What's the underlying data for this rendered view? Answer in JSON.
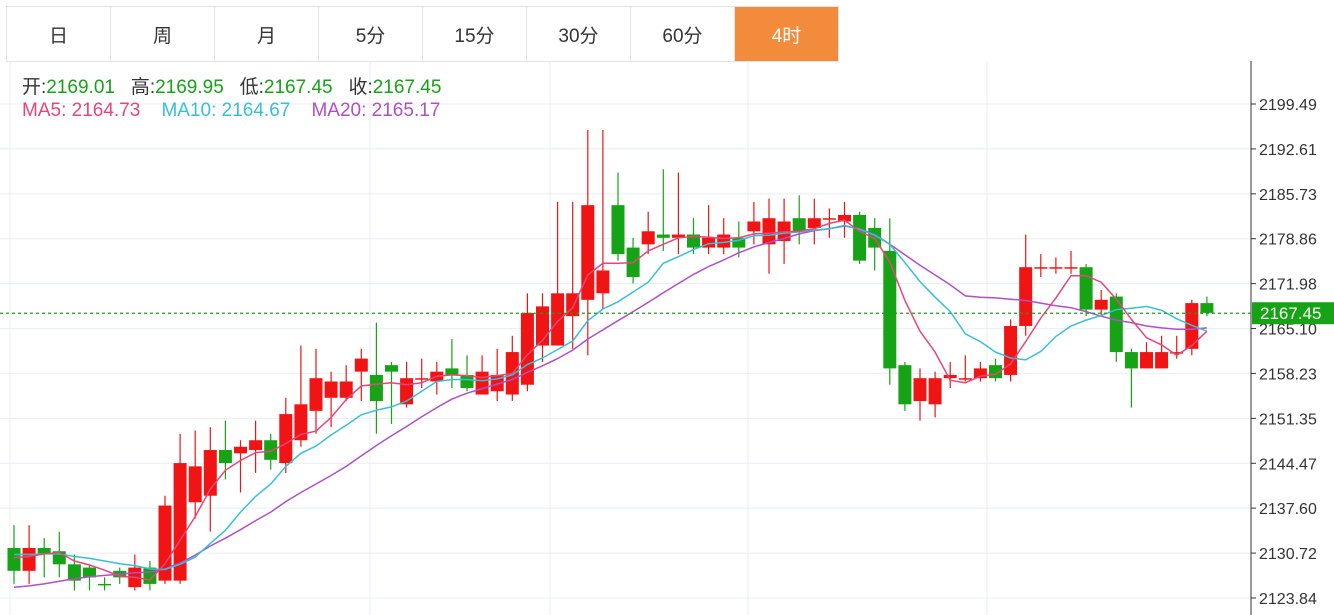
{
  "tabs": [
    {
      "label": "日",
      "active": false
    },
    {
      "label": "周",
      "active": false
    },
    {
      "label": "月",
      "active": false
    },
    {
      "label": "5分",
      "active": false
    },
    {
      "label": "15分",
      "active": false
    },
    {
      "label": "30分",
      "active": false
    },
    {
      "label": "60分",
      "active": false
    },
    {
      "label": "4时",
      "active": true
    }
  ],
  "ohlc_info": {
    "open_label": "开:",
    "open": "2169.01",
    "high_label": "高:",
    "high": "2169.95",
    "low_label": "低:",
    "low": "2167.45",
    "close_label": "收:",
    "close": "2167.45"
  },
  "ma_info": {
    "ma5_label": "MA5:",
    "ma5": "2164.73",
    "ma10_label": "MA10:",
    "ma10": "2164.67",
    "ma20_label": "MA20:",
    "ma20": "2165.17"
  },
  "colors": {
    "up": "#f01414",
    "down": "#16a316",
    "ma5": "#e8457a",
    "ma10": "#36c0d6",
    "ma20": "#b04fc7",
    "active_tab": "#f28b3c",
    "last_price": "#16a316"
  },
  "chart_data": {
    "type": "candlestick",
    "y_ticks": [
      "2199.49",
      "2192.61",
      "2185.73",
      "2178.86",
      "2171.98",
      "2165.10",
      "2158.23",
      "2151.35",
      "2144.47",
      "2137.60",
      "2130.72",
      "2123.84"
    ],
    "ylim": [
      2123.84,
      2199.49
    ],
    "last_price": 2167.45,
    "last_price_label": "2167.45",
    "grid": true,
    "candles": [
      [
        2131.5,
        2128.0,
        2135.0,
        2126.0
      ],
      [
        2128.0,
        2131.5,
        2135.0,
        2126.0
      ],
      [
        2131.5,
        2130.5,
        2133.0,
        2127.0
      ],
      [
        2131.0,
        2129.0,
        2134.0,
        2127.0
      ],
      [
        2129.0,
        2126.5,
        2130.5,
        2125.0
      ],
      [
        2128.5,
        2127.0,
        2129.0,
        2125.0
      ],
      [
        2126.0,
        2125.8,
        2127.0,
        2125.0
      ],
      [
        2128.0,
        2127.0,
        2128.5,
        2126.0
      ],
      [
        2125.5,
        2128.5,
        2130.5,
        2125.0
      ],
      [
        2128.5,
        2126.0,
        2129.5,
        2125.0
      ],
      [
        2126.5,
        2138.0,
        2139.5,
        2126.0
      ],
      [
        2126.5,
        2144.5,
        2149.0,
        2126.0
      ],
      [
        2138.5,
        2144.0,
        2149.5,
        2136.0
      ],
      [
        2139.5,
        2146.5,
        2150.0,
        2134.0
      ],
      [
        2146.5,
        2144.5,
        2151.0,
        2142.0
      ],
      [
        2146.0,
        2147.0,
        2148.0,
        2140.0
      ],
      [
        2146.5,
        2148.0,
        2151.0,
        2143.0
      ],
      [
        2148.0,
        2145.0,
        2149.0,
        2143.5
      ],
      [
        2144.5,
        2152.0,
        2154.5,
        2143.0
      ],
      [
        2148.0,
        2153.5,
        2162.5,
        2147.0
      ],
      [
        2152.5,
        2157.5,
        2162.0,
        2149.0
      ],
      [
        2154.5,
        2157.0,
        2158.5,
        2150.0
      ],
      [
        2154.5,
        2157.0,
        2159.5,
        2154.0
      ],
      [
        2158.5,
        2160.5,
        2162.0,
        2154.0
      ],
      [
        2158.0,
        2154.0,
        2166.0,
        2149.0
      ],
      [
        2159.5,
        2158.5,
        2160.0,
        2150.5
      ],
      [
        2153.5,
        2157.5,
        2160.0,
        2153.0
      ],
      [
        2157.5,
        2157.5,
        2160.5,
        2156.0
      ],
      [
        2157.0,
        2158.5,
        2160.0,
        2155.0
      ],
      [
        2159.0,
        2158.0,
        2163.5,
        2156.0
      ],
      [
        2158.0,
        2156.0,
        2161.0,
        2155.5
      ],
      [
        2155.0,
        2158.5,
        2161.0,
        2155.0
      ],
      [
        2155.5,
        2158.0,
        2162.0,
        2154.0
      ],
      [
        2155.0,
        2161.5,
        2164.0,
        2154.0
      ],
      [
        2156.5,
        2167.5,
        2170.5,
        2155.5
      ],
      [
        2162.5,
        2168.5,
        2170.5,
        2160.0
      ],
      [
        2162.5,
        2170.5,
        2184.5,
        2163.0
      ],
      [
        2167.0,
        2170.5,
        2184.5,
        2162.0
      ],
      [
        2169.5,
        2184.0,
        2195.5,
        2161.0
      ],
      [
        2170.5,
        2174.0,
        2195.5,
        2168.0
      ],
      [
        2184.0,
        2176.5,
        2189.0,
        2175.5
      ],
      [
        2177.5,
        2173.0,
        2179.0,
        2172.0
      ],
      [
        2178.0,
        2180.0,
        2183.0,
        2176.5
      ],
      [
        2179.5,
        2179.0,
        2189.5,
        2177.0
      ],
      [
        2179.0,
        2179.5,
        2189.0,
        2176.5
      ],
      [
        2179.5,
        2177.5,
        2182.0,
        2176.5
      ],
      [
        2177.5,
        2179.0,
        2184.0,
        2176.5
      ],
      [
        2177.5,
        2179.5,
        2182.0,
        2176.5
      ],
      [
        2179.0,
        2177.5,
        2181.5,
        2176.0
      ],
      [
        2180.0,
        2181.5,
        2184.5,
        2178.0
      ],
      [
        2178.0,
        2182.0,
        2185.0,
        2173.5
      ],
      [
        2178.5,
        2181.5,
        2185.0,
        2175.0
      ],
      [
        2182.0,
        2180.0,
        2185.5,
        2178.0
      ],
      [
        2180.5,
        2182.0,
        2185.0,
        2178.0
      ],
      [
        2182.0,
        2182.0,
        2183.5,
        2179.0
      ],
      [
        2181.5,
        2182.5,
        2184.5,
        2179.0
      ],
      [
        2182.5,
        2175.5,
        2183.0,
        2175.0
      ],
      [
        2180.5,
        2177.5,
        2182.0,
        2174.0
      ],
      [
        2177.0,
        2159.0,
        2182.0,
        2156.5
      ],
      [
        2159.5,
        2153.5,
        2160.0,
        2152.5
      ],
      [
        2154.0,
        2157.5,
        2159.0,
        2151.0
      ],
      [
        2153.5,
        2157.5,
        2158.5,
        2151.5
      ],
      [
        2157.5,
        2158.0,
        2160.0,
        2156.0
      ],
      [
        2157.5,
        2157.5,
        2161.0,
        2157.0
      ],
      [
        2157.5,
        2159.0,
        2160.0,
        2157.0
      ],
      [
        2159.5,
        2157.5,
        2160.5,
        2157.0
      ],
      [
        2158.0,
        2165.5,
        2166.5,
        2157.0
      ],
      [
        2165.5,
        2174.5,
        2179.5,
        2164.0
      ],
      [
        2174.5,
        2174.5,
        2176.5,
        2173.0
      ],
      [
        2174.5,
        2174.5,
        2176.0,
        2173.5
      ],
      [
        2174.5,
        2174.5,
        2177.0,
        2173.5
      ],
      [
        2174.5,
        2168.0,
        2175.0,
        2167.0
      ],
      [
        2168.0,
        2169.5,
        2171.0,
        2167.0
      ],
      [
        2170.0,
        2161.5,
        2170.5,
        2160.0
      ],
      [
        2161.5,
        2159.0,
        2162.0,
        2153.0
      ],
      [
        2159.0,
        2161.5,
        2163.0,
        2159.0
      ],
      [
        2159.0,
        2161.5,
        2164.0,
        2159.0
      ],
      [
        2161.5,
        2161.5,
        2164.0,
        2160.5
      ],
      [
        2162.0,
        2169.0,
        2169.5,
        2161.0
      ],
      [
        2169.0,
        2167.5,
        2170.0,
        2167.0
      ]
    ],
    "ma5": [
      2130.0,
      2130.2,
      2130.6,
      2130.8,
      2129.5,
      2128.9,
      2128.1,
      2127.2,
      2127.0,
      2126.6,
      2129.1,
      2132.7,
      2136.3,
      2140.5,
      2143.4,
      2144.9,
      2146.1,
      2146.3,
      2147.5,
      2148.9,
      2149.4,
      2151.5,
      2154.2,
      2156.3,
      2156.6,
      2156.8,
      2156.5,
      2156.8,
      2157.8,
      2158.0,
      2157.9,
      2157.6,
      2157.9,
      2158.2,
      2161.1,
      2163.3,
      2166.2,
      2168.3,
      2173.3,
      2175.1,
      2175.1,
      2175.2,
      2177.0,
      2178.0,
      2179.0,
      2179.2,
      2179.1,
      2178.9,
      2179.0,
      2179.6,
      2179.7,
      2179.9,
      2180.0,
      2180.4,
      2181.2,
      2181.7,
      2180.0,
      2178.9,
      2175.3,
      2169.4,
      2164.7,
      2161.5,
      2157.2,
      2156.8,
      2157.8,
      2158.1,
      2159.7,
      2163.1,
      2166.7,
      2169.8,
      2173.2,
      2173.2,
      2172.2,
      2169.6,
      2166.5,
      2163.7,
      2162.6,
      2161.0,
      2162.5,
      2164.7
    ],
    "ma10": [
      2130.5,
      2130.5,
      2130.6,
      2130.6,
      2130.2,
      2129.9,
      2129.5,
      2129.1,
      2128.8,
      2128.3,
      2128.2,
      2129.0,
      2130.1,
      2132.2,
      2134.2,
      2137.0,
      2139.4,
      2141.3,
      2144.0,
      2146.0,
      2147.1,
      2148.8,
      2150.3,
      2151.9,
      2152.6,
      2153.1,
      2154.0,
      2155.5,
      2157.0,
      2157.3,
      2157.3,
      2157.1,
      2157.4,
      2158.0,
      2159.6,
      2160.6,
      2161.9,
      2163.2,
      2166.3,
      2168.1,
      2169.2,
      2170.7,
      2172.2,
      2175.1,
      2176.1,
      2177.2,
      2178.1,
      2178.3,
      2178.6,
      2179.3,
      2179.4,
      2179.7,
      2179.9,
      2180.2,
      2180.4,
      2180.9,
      2180.3,
      2179.4,
      2178.0,
      2175.2,
      2172.3,
      2169.9,
      2167.7,
      2164.3,
      2163.1,
      2161.5,
      2160.6,
      2160.3,
      2161.6,
      2163.9,
      2165.5,
      2166.4,
      2167.1,
      2168.0,
      2168.2,
      2168.5,
      2167.9,
      2166.6,
      2165.6,
      2164.7
    ],
    "ma20": [
      2125.5,
      2125.7,
      2126.0,
      2126.4,
      2126.8,
      2127.1,
      2127.3,
      2127.5,
      2127.7,
      2127.8,
      2128.3,
      2129.2,
      2130.4,
      2131.8,
      2133.0,
      2134.3,
      2135.7,
      2137.0,
      2138.6,
      2140.0,
      2141.3,
      2142.6,
      2144.0,
      2145.6,
      2147.2,
      2148.7,
      2150.1,
      2151.6,
      2153.0,
      2154.3,
      2155.2,
      2155.9,
      2156.6,
      2157.3,
      2158.4,
      2159.4,
      2160.5,
      2161.8,
      2163.5,
      2164.9,
      2166.3,
      2167.7,
      2169.1,
      2170.6,
      2172.0,
      2173.4,
      2174.6,
      2175.6,
      2176.7,
      2177.6,
      2178.3,
      2178.9,
      2179.6,
      2180.1,
      2180.4,
      2180.8,
      2180.4,
      2179.5,
      2178.0,
      2176.4,
      2174.8,
      2173.3,
      2171.8,
      2170.1,
      2169.9,
      2169.8,
      2169.6,
      2169.4,
      2169.0,
      2168.6,
      2168.3,
      2167.7,
      2167.0,
      2166.4,
      2166.0,
      2165.5,
      2165.2,
      2165.0,
      2165.0,
      2165.2
    ]
  }
}
